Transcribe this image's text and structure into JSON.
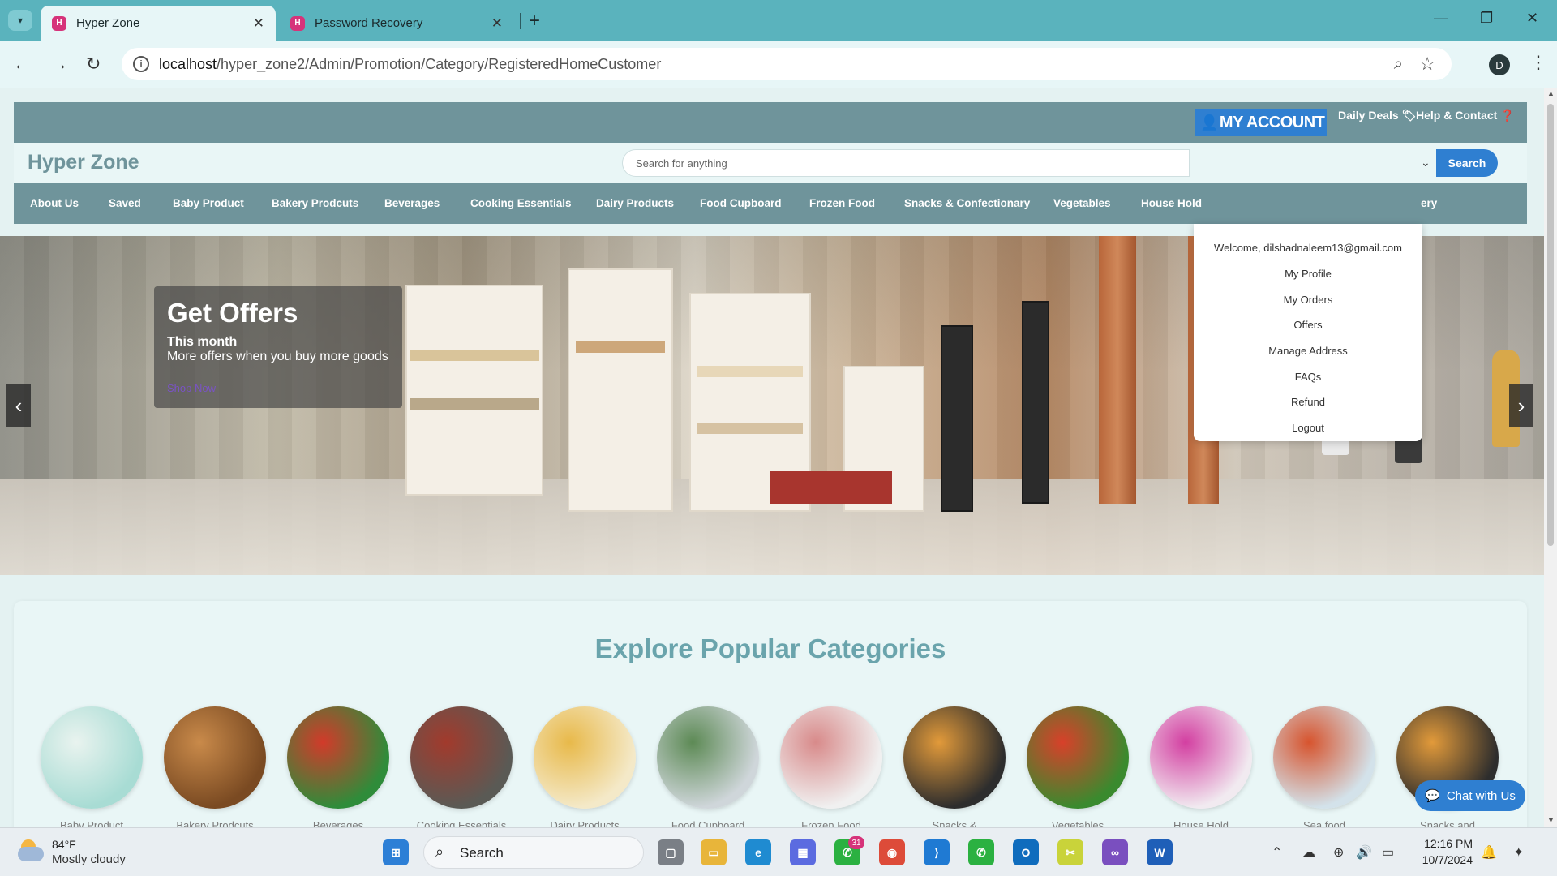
{
  "browser": {
    "tabs": [
      {
        "title": "Hyper Zone",
        "active": true
      },
      {
        "title": "Password Recovery",
        "active": false
      }
    ],
    "url_host": "localhost",
    "url_path": "/hyper_zone2/Admin/Promotion/Category/RegisteredHomeCustomer",
    "profile_initial": "D"
  },
  "header": {
    "my_account": "MY ACCOUNT",
    "daily_deals": "Daily Deals",
    "help_contact": "Help & Contact"
  },
  "brand": {
    "name": "Hyper Zone",
    "search_placeholder": "Search for anything",
    "search_button": "Search"
  },
  "nav": {
    "items": [
      "About Us",
      "Saved",
      "Baby Product",
      "Bakery Prodcuts",
      "Beverages",
      "Cooking Essentials",
      "Dairy Products",
      "Food Cupboard",
      "Frozen Food",
      "Snacks & Confectionary",
      "Vegetables",
      "House Hold",
      "ery"
    ]
  },
  "account_menu": {
    "welcome": "Welcome, dilshadnaleem13@gmail.com",
    "items": [
      "My Profile",
      "My Orders",
      "Offers",
      "Manage Address",
      "FAQs",
      "Refund",
      "Logout"
    ]
  },
  "hero": {
    "title": "Get Offers",
    "subtitle": "This month",
    "description": "More offers when you buy more goods",
    "link": "Shop Now"
  },
  "categories": {
    "title": "Explore Popular Categories",
    "items": [
      {
        "label": "Baby Product",
        "color1": "#a8dcd4",
        "color2": "#e9f3ef"
      },
      {
        "label": "Bakery Prodcuts",
        "color1": "#7a4a22",
        "color2": "#c98a4a"
      },
      {
        "label": "Beverages",
        "color1": "#2f8c3a",
        "color2": "#d23a2a"
      },
      {
        "label": "Cooking Essentials",
        "color1": "#5a5a55",
        "color2": "#a23a2c"
      },
      {
        "label": "Dairy Products",
        "color1": "#f4e9c8",
        "color2": "#e8b94a"
      },
      {
        "label": "Food Cupboard",
        "color1": "#cfd6da",
        "color2": "#5d8a55"
      },
      {
        "label": "Frozen Food",
        "color1": "#f0f0f0",
        "color2": "#d88a8a"
      },
      {
        "label": "Snacks &",
        "color1": "#2d2d2d",
        "color2": "#e29a3a"
      },
      {
        "label": "Vegetables",
        "color1": "#3a8a2e",
        "color2": "#d8402a"
      },
      {
        "label": "House Hold",
        "color1": "#f1eaf0",
        "color2": "#d33fa1"
      },
      {
        "label": "Sea food",
        "color1": "#d3e2ea",
        "color2": "#d7542e"
      },
      {
        "label": "Snacks and",
        "color1": "#2d2d2d",
        "color2": "#e29a3a"
      }
    ]
  },
  "chat": {
    "label": "Chat with Us"
  },
  "taskbar": {
    "temp": "84°F",
    "weather": "Mostly cloudy",
    "search": "Search",
    "whatsapp_badge": "31",
    "time": "12:16 PM",
    "date": "10/7/2024"
  }
}
